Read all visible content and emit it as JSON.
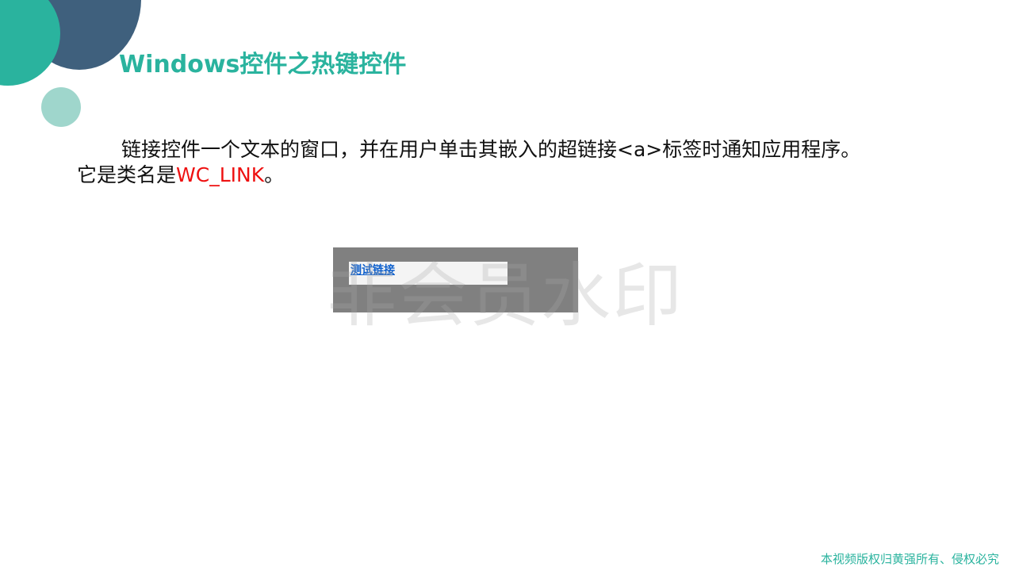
{
  "slide": {
    "title": "Windows控件之热键控件",
    "paragraph": {
      "text_before": "链接控件一个文本的窗口，并在用户单击其嵌入的超链接<a>标签时通知应用程序。它是类名是",
      "highlight": "WC_LINK",
      "text_after": "。"
    },
    "demo": {
      "link_text": "测试链接"
    },
    "watermark": "非会员水印",
    "copyright": "本视频版权归黄强所有、侵权必究"
  },
  "colors": {
    "accent_teal": "#2ab39e",
    "dark_blue": "#3f607d",
    "light_teal": "#9fd6cc",
    "highlight_red": "#ee1111",
    "link_blue": "#0d5fcc",
    "demo_gray": "#808080"
  }
}
